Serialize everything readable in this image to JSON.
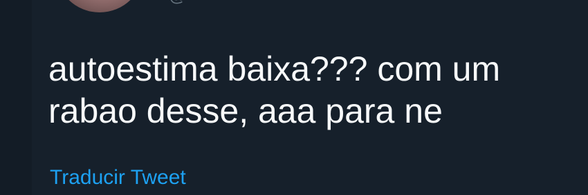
{
  "tweet": {
    "handle_fragment": "@",
    "text": "autoestima baixa??? com um\nrabao desse, aaa para ne",
    "translate_label": "Traducir Tweet"
  },
  "colors": {
    "background": "#16202b",
    "text": "#f7f9fa",
    "link": "#1da1f2",
    "muted": "#66747f"
  }
}
